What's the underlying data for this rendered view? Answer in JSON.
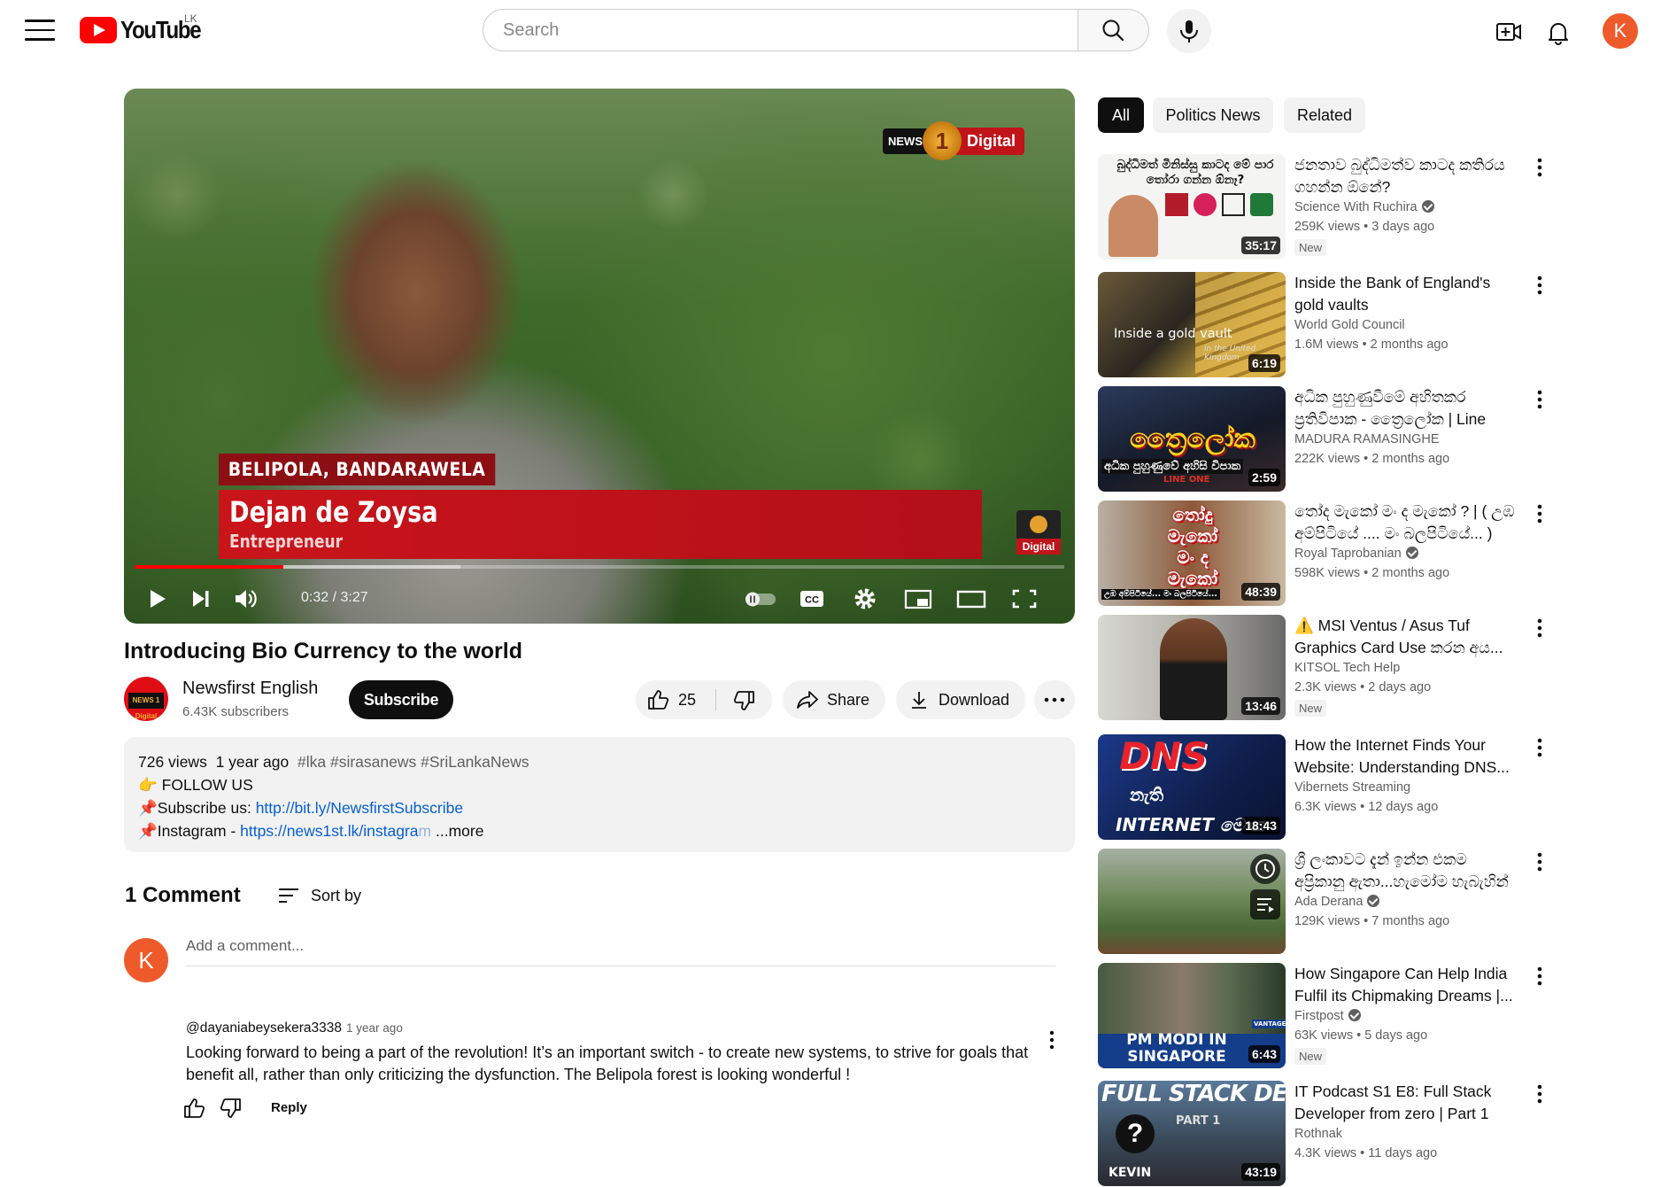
{
  "header": {
    "logo_text": "YouTube",
    "country_code": "LK",
    "search_placeholder": "Search",
    "user_initial": "K"
  },
  "player": {
    "overlay": {
      "bug_left": "NEWS",
      "bug_number": "1",
      "bug_right": "Digital",
      "location": "BELIPOLA, BANDARAWELA",
      "person_name": "Dejan de Zoysa",
      "person_role": "Entrepreneur",
      "corner_label": "Digital"
    },
    "time": "0:32 / 3:27",
    "progress_fraction": 0.16,
    "buffered_fraction": 0.35
  },
  "video": {
    "title": "Introducing Bio Currency to the world",
    "channel_name": "Newsfirst English",
    "subscribers": "6.43K subscribers",
    "avatar_text": "NEWS 1 Digital",
    "subscribe_label": "Subscribe",
    "likes": "25",
    "share_label": "Share",
    "download_label": "Download"
  },
  "description": {
    "views": "726 views",
    "age": "1 year ago",
    "hashtags": "#lka #sirasanews #SriLankaNews",
    "line2_emoji": "👉",
    "line2": "FOLLOW US",
    "line3_emoji": "📌",
    "line3_prefix": "Subscribe us: ",
    "line3_link": "http://bit.ly/NewsfirstSubscribe",
    "line4_emoji": "📌",
    "line4_prefix": "Instagram - ",
    "line4_link": "https://news1st.lk/instagra",
    "line4_link_fade": "m",
    "more_label": "...more"
  },
  "comments": {
    "count_label": "1 Comment",
    "sort_label": "Sort by",
    "add_placeholder": "Add a comment...",
    "my_initial": "K",
    "items": [
      {
        "author": "@dayaniabeysekera3338",
        "age": "1 year ago",
        "text": "Looking forward to being a part of the revolution! It’s an important switch - to create new systems, to strive for goals that benefit all, rather than only criticizing the dysfunction. The Belipola forest is looking wonderful !",
        "reply_label": "Reply"
      }
    ]
  },
  "chips": [
    "All",
    "Politics News",
    "Related"
  ],
  "recommendations": [
    {
      "title": "ජනතාව බුද්ධිමත්ව කාටද කතිරය ගහන්න ඕනේ?",
      "channel": "Science With Ruchira",
      "verified": true,
      "meta": "259K views  • 3 days ago",
      "badge": "New",
      "duration": "35:17",
      "thumb_text": "බුද්ධිමත් මිනිස්සු කාටද මේ පාර\nතෝරා ගන්න ඕනෑ?"
    },
    {
      "title": "Inside the Bank of England's gold vaults",
      "channel": "World Gold Council",
      "verified": false,
      "meta": "1.6M views  • 2 months ago",
      "badge": "",
      "duration": "6:19",
      "thumb_text": "Inside a gold vault",
      "thumb_sub": "in the United Kingdom"
    },
    {
      "title": "අධික පුහුණුවීමේ අහිතකර ප්‍රතිවිපාක - ත්‍රෛලෝක | Line One",
      "channel": "MADURA RAMASINGHE",
      "verified": false,
      "meta": "222K views  • 2 months ago",
      "badge": "",
      "duration": "2:59",
      "thumb_text": "ත්‍රෛලෝක",
      "thumb_sub": "අධික පුහුණුවේ අහිසි විපාක",
      "thumb_brand": "LINE ONE"
    },
    {
      "title": "තෝද මැකෝ මං ද මැකෝ ? | ( උඹ අම්පිටියේ .... මං බලපිටියේ... )",
      "channel": "Royal Taprobanian",
      "verified": true,
      "meta": "598K views  • 2 months ago",
      "badge": "",
      "duration": "48:39",
      "thumb_text": "තෝදු මැකෝ\nමං ද\nමැකෝ",
      "thumb_sub": "උඹ අම්පිටියේ... මං බලපිටියේ..."
    },
    {
      "title": "⚠️ MSI Ventus / Asus Tuf Graphics Card Use කරන අය...",
      "channel": "KITSOL Tech Help",
      "verified": false,
      "meta": "2.3K views  • 2 days ago",
      "badge": "New",
      "duration": "13:46",
      "thumb_text": ""
    },
    {
      "title": "How the Internet Finds Your Website: Understanding DNS...",
      "channel": "Vibernets Streaming",
      "verified": false,
      "meta": "6.3K views  • 12 days ago",
      "badge": "",
      "duration": "18:43",
      "thumb_text": "DNS",
      "thumb_sub": "නැති",
      "thumb_brand": "INTERNET මොක"
    },
    {
      "title": "ශ්‍රී ලංකාවට දැන් ඉන්න එකම අප්‍රිකානු ඇතා...හැමෝම හැබැහින් දැකිය යුතු...",
      "channel": "Ada Derana",
      "verified": true,
      "meta": "129K views  • 7 months ago",
      "badge": "",
      "duration": "",
      "thumb_text": ""
    },
    {
      "title": "How Singapore Can Help India Fulfil its Chipmaking Dreams |...",
      "channel": "Firstpost",
      "verified": true,
      "meta": "63K views  • 5 days ago",
      "badge": "New",
      "duration": "6:43",
      "thumb_text": "PM MODI IN\nSINGAPORE",
      "thumb_brand": "VANTAGE"
    },
    {
      "title": "IT Podcast S1 E8: Full Stack Developer from zero | Part 1",
      "channel": "Rothnak",
      "verified": false,
      "meta": "4.3K views  • 11 days ago",
      "badge": "",
      "duration": "43:19",
      "thumb_text": "FULL STACK DEV",
      "thumb_sub": "PART 1",
      "thumb_brand": "KEVIN"
    }
  ],
  "colors": {
    "brand_red": "#ff0000",
    "avatar_orange": "#ef5a2b",
    "link_blue": "#065fd4",
    "chip_active": "#0f0f0f",
    "chip_idle": "#f2f2f2"
  },
  "icons": [
    "menu-icon",
    "search-icon",
    "mic-icon",
    "create-icon",
    "bell-icon",
    "play-icon",
    "next-icon",
    "volume-icon",
    "autoplay-toggle-icon",
    "captions-icon",
    "settings-icon",
    "miniplayer-icon",
    "theater-icon",
    "fullscreen-icon",
    "like-icon",
    "dislike-icon",
    "share-icon",
    "download-icon",
    "more-icon",
    "sort-icon",
    "kebab-icon",
    "verified-icon",
    "clock-icon",
    "queue-icon"
  ]
}
